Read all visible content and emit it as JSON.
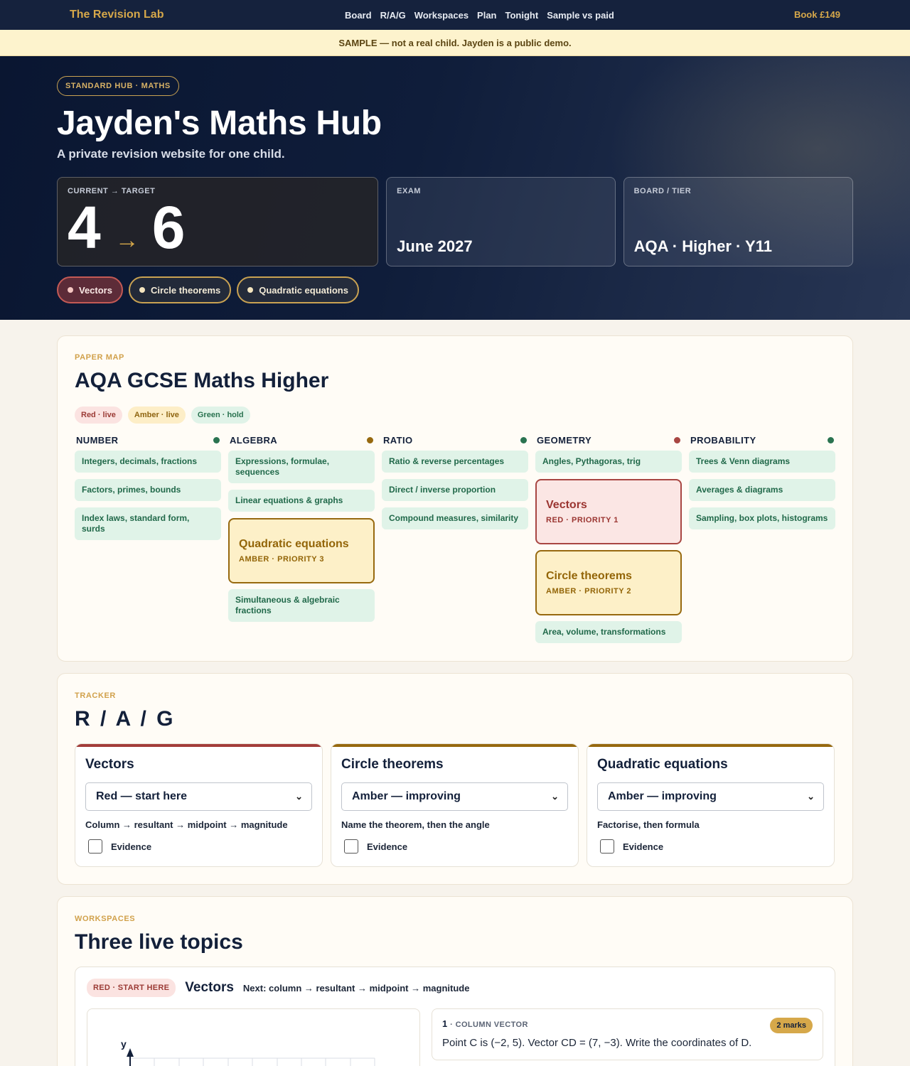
{
  "nav": {
    "brand": "The Revision Lab",
    "links": [
      "Board",
      "R/A/G",
      "Workspaces",
      "Plan",
      "Tonight",
      "Sample vs paid"
    ],
    "book": "Book £149"
  },
  "banner": "SAMPLE — not a real child. Jayden is a public demo.",
  "hero": {
    "pill": "STANDARD HUB · MATHS",
    "title": "Jayden's Maths Hub",
    "subtitle": "A private revision website for one child.",
    "grade_label": "CURRENT → TARGET",
    "current_grade": "4",
    "grade_arrow": "→",
    "target_grade": "6",
    "exam_label": "EXAM",
    "exam_value": "June 2027",
    "board_label": "BOARD / TIER",
    "board_value": "AQA · Higher · Y11",
    "chips": [
      "Vectors",
      "Circle theorems",
      "Quadratic equations"
    ]
  },
  "paper_map": {
    "eyebrow": "PAPER MAP",
    "title": "AQA GCSE Maths Higher",
    "legend": [
      "Red · live",
      "Amber · live",
      "Green · hold"
    ],
    "colors": {
      "red": "#a84642",
      "amber": "#97690f",
      "green": "#2a7350"
    },
    "columns": [
      {
        "title": "NUMBER",
        "status": "green",
        "tiles": [
          "Integers, decimals, fractions",
          "Factors, primes, bounds",
          "Index laws, standard form, surds"
        ]
      },
      {
        "title": "ALGEBRA",
        "status": "amber",
        "tiles": [
          "Expressions, formulae, sequences",
          "Linear equations & graphs"
        ],
        "focus": {
          "title": "Quadratic equations",
          "sub": "AMBER · PRIORITY 3"
        },
        "tiles_after": [
          "Simultaneous & algebraic fractions"
        ]
      },
      {
        "title": "RATIO",
        "status": "green",
        "tiles": [
          "Ratio & reverse percentages",
          "Direct / inverse proportion",
          "Compound measures, similarity"
        ]
      },
      {
        "title": "GEOMETRY",
        "status": "red",
        "tiles": [
          "Angles, Pythagoras, trig"
        ],
        "focus": {
          "title": "Vectors",
          "sub": "RED · PRIORITY 1"
        },
        "focus2": {
          "title": "Circle theorems",
          "sub": "AMBER · PRIORITY 2"
        },
        "tiles_after": [
          "Area, volume, transformations"
        ]
      },
      {
        "title": "PROBABILITY",
        "status": "green",
        "tiles": [
          "Trees & Venn diagrams",
          "Averages & diagrams",
          "Sampling, box plots, histograms"
        ]
      }
    ]
  },
  "tracker": {
    "eyebrow": "TRACKER",
    "title": "R / A / G",
    "cards": [
      {
        "topic": "Vectors",
        "status": "Red — start here",
        "hint": "Column → resultant → midpoint → magnitude",
        "evidence": "Evidence"
      },
      {
        "topic": "Circle theorems",
        "status": "Amber — improving",
        "hint": "Name the theorem, then the angle",
        "evidence": "Evidence"
      },
      {
        "topic": "Quadratic equations",
        "status": "Amber — improving",
        "hint": "Factorise, then formula",
        "evidence": "Evidence"
      }
    ]
  },
  "workspaces": {
    "eyebrow": "WORKSPACES",
    "title": "Three live topics",
    "first": {
      "badge": "RED · START HERE",
      "name": "Vectors",
      "next": "Next: column → resultant → midpoint → magnitude",
      "graph_axis": "y",
      "question": {
        "number": "1",
        "sep": " · ",
        "type": "COLUMN VECTOR",
        "marks": "2 marks",
        "text": "Point C is (−2, 5). Vector CD = (7, −3). Write the coordinates of D."
      }
    }
  }
}
